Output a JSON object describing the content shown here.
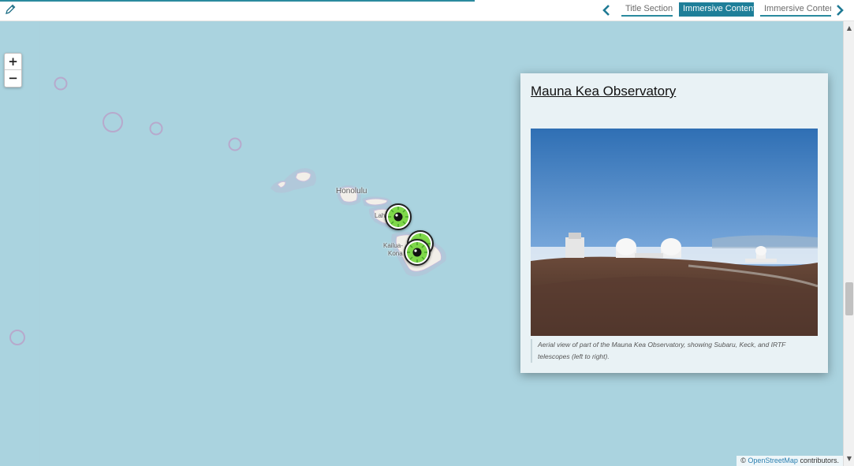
{
  "header": {
    "edit_icon": "pencil-icon",
    "prev_icon": "chevron-left-icon",
    "next_icon": "chevron-right-icon",
    "tabs": [
      {
        "label": "Title Section",
        "active": false
      },
      {
        "label": "Immersive Content",
        "active": true
      },
      {
        "label": "Immersive Content",
        "active": false
      }
    ],
    "accent_color": "#1e7f99"
  },
  "map": {
    "zoom_in_label": "+",
    "zoom_out_label": "−",
    "labels": {
      "honolulu": "Honolulu",
      "lahaina": "Lah",
      "kailua": "Kailua-",
      "kona": "Kona"
    },
    "marker_icon": "observatory-marker-icon",
    "marker_color": "#7fd84a",
    "attribution": {
      "prefix": "©",
      "link": "OpenStreetMap",
      "suffix": "contributors."
    }
  },
  "panel": {
    "title": "Mauna Kea Observatory",
    "caption": "Aerial view of part of the Mauna Kea Observatory, showing Subaru, Keck, and IRTF telescopes (left to right)."
  },
  "scrollbar": {
    "up": "▲",
    "down": "▼"
  }
}
